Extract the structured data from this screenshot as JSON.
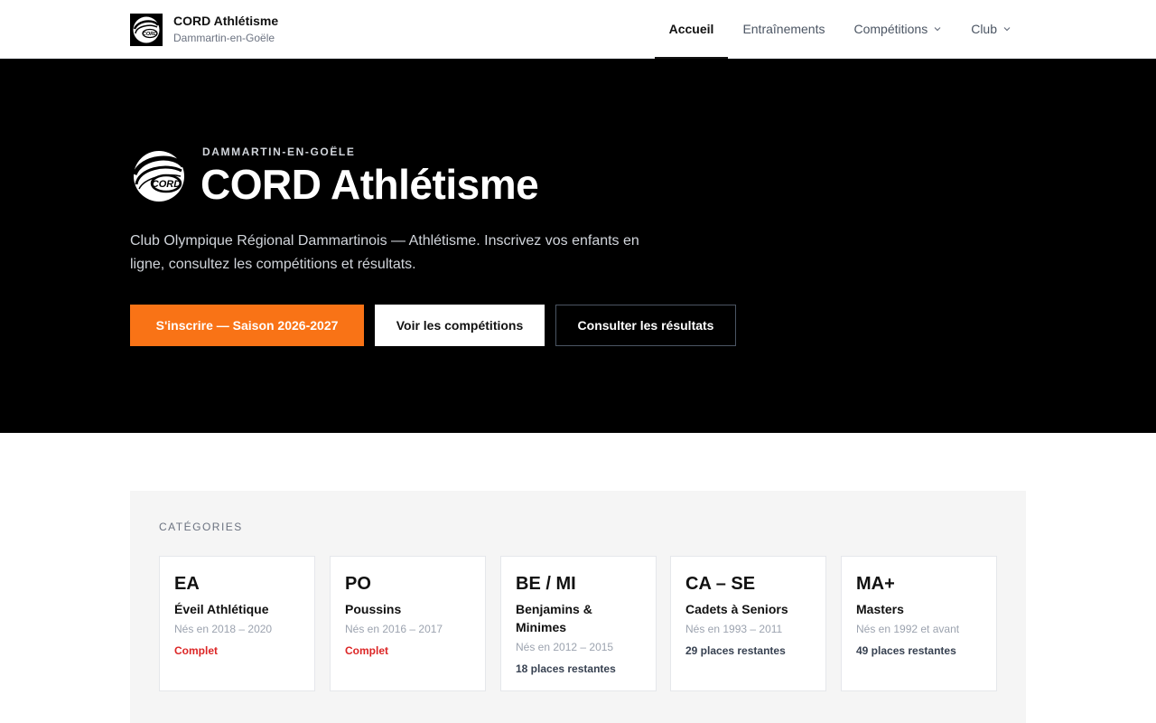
{
  "header": {
    "brand_name": "CORD Athlétisme",
    "brand_sub": "Dammartin-en-Goële",
    "logo_text": "CORD",
    "nav": [
      {
        "label": "Accueil",
        "active": true,
        "dropdown": false
      },
      {
        "label": "Entraînements",
        "active": false,
        "dropdown": false
      },
      {
        "label": "Compétitions",
        "active": false,
        "dropdown": true
      },
      {
        "label": "Club",
        "active": false,
        "dropdown": true
      }
    ]
  },
  "hero": {
    "kicker": "DAMMARTIN-EN-GOËLE",
    "title": "CORD Athlétisme",
    "description": "Club Olympique Régional Dammartinois — Athlétisme. Inscrivez vos enfants en ligne, consultez les compétitions et résultats.",
    "buttons": {
      "primary": "S'inscrire — Saison 2026-2027",
      "competitions": "Voir les compétitions",
      "results": "Consulter les résultats"
    }
  },
  "categories": {
    "heading": "CATÉGORIES",
    "items": [
      {
        "code": "EA",
        "name": "Éveil Athlétique",
        "years": "Nés en 2018 – 2020",
        "status": "Complet",
        "full": true
      },
      {
        "code": "PO",
        "name": "Poussins",
        "years": "Nés en 2016 – 2017",
        "status": "Complet",
        "full": true
      },
      {
        "code": "BE / MI",
        "name": "Benjamins & Minimes",
        "years": "Nés en 2012 – 2015",
        "status": "18 places restantes",
        "full": false
      },
      {
        "code": "CA – SE",
        "name": "Cadets à Seniors",
        "years": "Nés en 1993 – 2011",
        "status": "29 places restantes",
        "full": false
      },
      {
        "code": "MA+",
        "name": "Masters",
        "years": "Nés en 1992 et avant",
        "status": "49 places restantes",
        "full": false
      }
    ]
  },
  "colors": {
    "accent": "#f97316",
    "hero_bg": "#000000",
    "status_full": "#dc2626"
  }
}
